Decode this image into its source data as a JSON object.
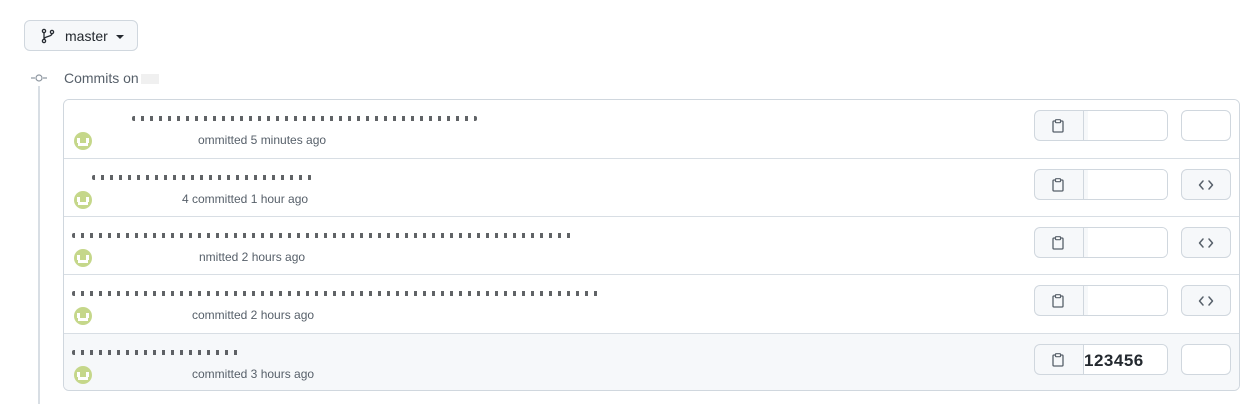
{
  "branch": {
    "name": "master",
    "icon": "git-branch-icon"
  },
  "timeline": {
    "heading": "Commits on",
    "node_icon": "git-commit-icon"
  },
  "commits": [
    {
      "meta": "ommitted 5 minutes ago",
      "sha": "",
      "browse_visible": false,
      "hover": false
    },
    {
      "meta": "4 committed 1 hour ago",
      "sha": "",
      "browse_visible": true,
      "hover": false
    },
    {
      "meta": "nmitted 2 hours ago",
      "sha": "",
      "browse_visible": true,
      "hover": false
    },
    {
      "meta": "committed 2 hours ago",
      "sha": "",
      "browse_visible": true,
      "hover": false
    },
    {
      "meta": "committed 3 hours ago",
      "sha": "123456",
      "browse_visible": false,
      "hover": true
    }
  ],
  "colors": {
    "border": "#d0d7de",
    "muted_text": "#57606a",
    "button_bg": "#f6f8fa",
    "avatar": "#c5d78a"
  }
}
